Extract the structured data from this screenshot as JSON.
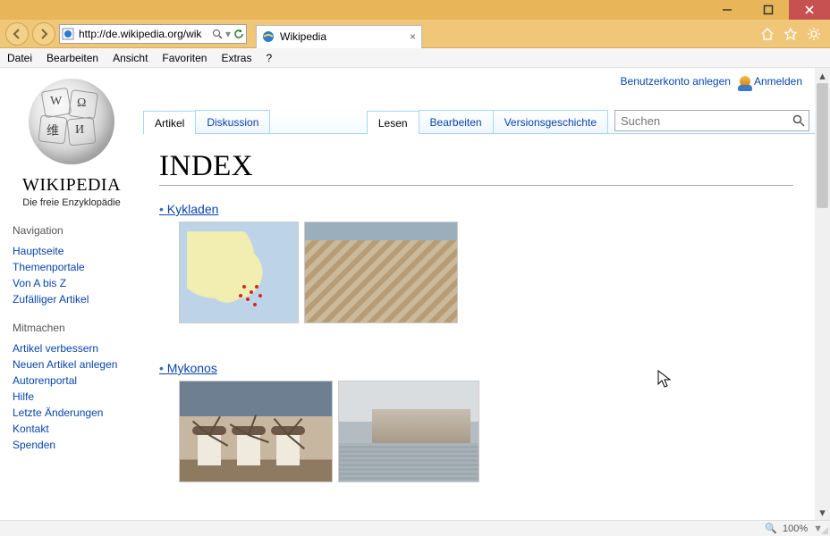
{
  "browser": {
    "url": "http://de.wikipedia.org/wik",
    "tab_title": "Wikipedia",
    "zoom_label": "100%"
  },
  "menus": {
    "items": [
      "Datei",
      "Bearbeiten",
      "Ansicht",
      "Favoriten",
      "Extras",
      "?"
    ]
  },
  "userlinks": {
    "create": "Benutzerkonto anlegen",
    "login": "Anmelden"
  },
  "logo": {
    "wordmark": "WIKIPEDIA",
    "tagline": "Die freie Enzyklopädie"
  },
  "sidebar": {
    "nav_heading": "Navigation",
    "nav_items": [
      "Hauptseite",
      "Themenportale",
      "Von A bis Z",
      "Zufälliger Artikel"
    ],
    "contrib_heading": "Mitmachen",
    "contrib_items": [
      "Artikel verbessern",
      "Neuen Artikel anlegen",
      "Autorenportal",
      "Hilfe",
      "Letzte Änderungen",
      "Kontakt",
      "Spenden"
    ]
  },
  "tabs": {
    "left": [
      {
        "label": "Artikel",
        "selected": true
      },
      {
        "label": "Diskussion",
        "selected": false
      }
    ],
    "right": [
      {
        "label": "Lesen",
        "selected": true
      },
      {
        "label": "Bearbeiten",
        "selected": false
      },
      {
        "label": "Versionsgeschichte",
        "selected": false
      }
    ],
    "search_placeholder": "Suchen"
  },
  "article": {
    "title": "INDEX",
    "entries": [
      {
        "name": "Kykladen"
      },
      {
        "name": "Mykonos"
      }
    ]
  }
}
